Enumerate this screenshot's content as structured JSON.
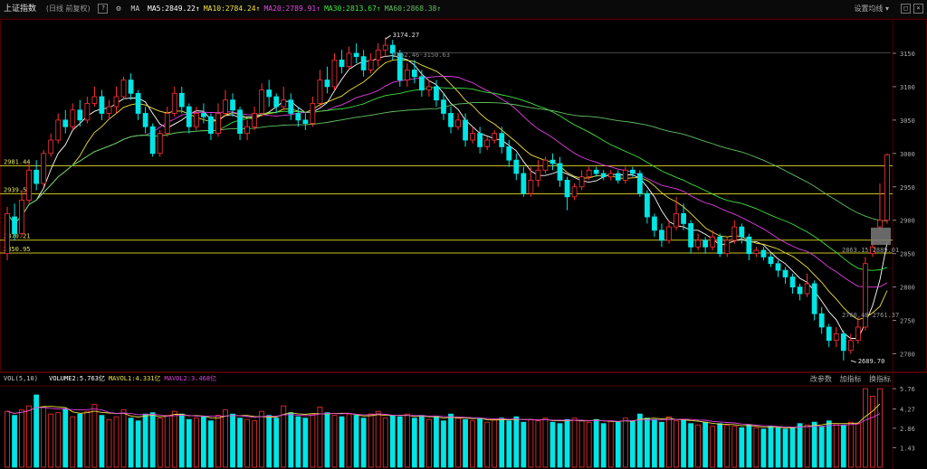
{
  "header": {
    "title": "上证指数",
    "subtitle": "(日线 前复权)",
    "help": "?",
    "ma_label": "MA",
    "ma": [
      {
        "label": "MA5:2849.22",
        "color": "#ffffff"
      },
      {
        "label": "MA10:2784.24",
        "color": "#f0e040"
      },
      {
        "label": "MA20:2789.91",
        "color": "#e040e0"
      },
      {
        "label": "MA30:2813.67",
        "color": "#40e040"
      },
      {
        "label": "MA60:2868.38",
        "color": "#60c060"
      }
    ],
    "settings": "设置均线"
  },
  "volume_header": {
    "title": "VOL(5,10)",
    "items": [
      {
        "label": "VOLUME2:5.763亿",
        "color": "#ffffff"
      },
      {
        "label": "MAVOL1:4.331亿",
        "color": "#f0e040"
      },
      {
        "label": "MAVOL2:3.468亿",
        "color": "#e040e0"
      }
    ],
    "right": [
      "改参数",
      "加指标",
      "换指标"
    ]
  },
  "chart_data": {
    "type": "candlestick",
    "price_axis": {
      "ticks": [
        3150,
        3100,
        3050,
        3000,
        2950,
        2900,
        2850,
        2800,
        2750,
        2700
      ],
      "ylim": [
        2675,
        3200
      ]
    },
    "volume_axis": {
      "ticks": [
        "5.76",
        "4.27",
        "2.86",
        "1.43"
      ]
    },
    "reference_lines": [
      {
        "value": 2981.44,
        "label": "2981.44"
      },
      {
        "value": 2939.53,
        "label": "2939.53"
      },
      {
        "value": 2870.21,
        "label": "2870.21"
      },
      {
        "value": 2850.95,
        "label": "2850.95"
      }
    ],
    "annotations": {
      "high": "3174.27",
      "high_range": "3162.46-3150.63",
      "low": "2689.70",
      "gap_top": "2863.15-2889.01",
      "gap_bottom": "2760.48-2761.37"
    },
    "candles": [
      [
        2850,
        2910,
        2840,
        2920
      ],
      [
        2905,
        2880,
        2870,
        2925
      ],
      [
        2880,
        2930,
        2875,
        2945
      ],
      [
        2930,
        2975,
        2925,
        2985
      ],
      [
        2975,
        2955,
        2945,
        2990
      ],
      [
        2955,
        3000,
        2950,
        3005
      ],
      [
        3000,
        3020,
        2995,
        3030
      ],
      [
        3020,
        3050,
        3015,
        3060
      ],
      [
        3050,
        3040,
        3030,
        3065
      ],
      [
        3040,
        3065,
        3035,
        3075
      ],
      [
        3065,
        3050,
        3040,
        3080
      ],
      [
        3050,
        3075,
        3045,
        3085
      ],
      [
        3075,
        3085,
        3070,
        3100
      ],
      [
        3085,
        3060,
        3050,
        3095
      ],
      [
        3060,
        3070,
        3050,
        3080
      ],
      [
        3070,
        3085,
        3060,
        3100
      ],
      [
        3085,
        3110,
        3080,
        3115
      ],
      [
        3110,
        3090,
        3080,
        3120
      ],
      [
        3090,
        3060,
        3050,
        3095
      ],
      [
        3060,
        3040,
        3030,
        3070
      ],
      [
        3040,
        3000,
        2995,
        3045
      ],
      [
        3000,
        3030,
        2995,
        3035
      ],
      [
        3030,
        3060,
        3025,
        3070
      ],
      [
        3060,
        3090,
        3055,
        3100
      ],
      [
        3090,
        3070,
        3060,
        3100
      ],
      [
        3070,
        3040,
        3030,
        3075
      ],
      [
        3040,
        3060,
        3035,
        3070
      ],
      [
        3060,
        3055,
        3045,
        3075
      ],
      [
        3055,
        3030,
        3020,
        3060
      ],
      [
        3030,
        3060,
        3025,
        3075
      ],
      [
        3060,
        3080,
        3055,
        3095
      ],
      [
        3080,
        3065,
        3055,
        3090
      ],
      [
        3065,
        3030,
        3020,
        3070
      ],
      [
        3030,
        3040,
        3020,
        3050
      ],
      [
        3040,
        3060,
        3035,
        3070
      ],
      [
        3060,
        3095,
        3055,
        3105
      ],
      [
        3095,
        3085,
        3070,
        3110
      ],
      [
        3085,
        3070,
        3060,
        3090
      ],
      [
        3070,
        3080,
        3065,
        3100
      ],
      [
        3080,
        3060,
        3050,
        3090
      ],
      [
        3060,
        3050,
        3040,
        3070
      ],
      [
        3050,
        3045,
        3035,
        3060
      ],
      [
        3045,
        3075,
        3040,
        3085
      ],
      [
        3075,
        3110,
        3070,
        3125
      ],
      [
        3110,
        3100,
        3090,
        3130
      ],
      [
        3100,
        3140,
        3095,
        3150
      ],
      [
        3140,
        3130,
        3120,
        3155
      ],
      [
        3130,
        3150,
        3125,
        3160
      ],
      [
        3150,
        3145,
        3135,
        3165
      ],
      [
        3145,
        3125,
        3115,
        3155
      ],
      [
        3125,
        3140,
        3120,
        3150
      ],
      [
        3140,
        3155,
        3130,
        3165
      ],
      [
        3155,
        3162,
        3145,
        3174
      ],
      [
        3162,
        3150,
        3140,
        3170
      ],
      [
        3150,
        3110,
        3100,
        3155
      ],
      [
        3110,
        3125,
        3100,
        3135
      ],
      [
        3125,
        3115,
        3105,
        3140
      ],
      [
        3115,
        3095,
        3085,
        3125
      ],
      [
        3095,
        3100,
        3085,
        3110
      ],
      [
        3100,
        3080,
        3070,
        3110
      ],
      [
        3080,
        3060,
        3050,
        3090
      ],
      [
        3060,
        3040,
        3030,
        3070
      ],
      [
        3040,
        3050,
        3035,
        3060
      ],
      [
        3050,
        3020,
        3010,
        3060
      ],
      [
        3020,
        3030,
        3015,
        3040
      ],
      [
        3030,
        3010,
        3000,
        3040
      ],
      [
        3010,
        3020,
        3005,
        3025
      ],
      [
        3020,
        3030,
        3015,
        3035
      ],
      [
        3030,
        3010,
        3000,
        3040
      ],
      [
        3010,
        2990,
        2980,
        3020
      ],
      [
        2990,
        2970,
        2960,
        3000
      ],
      [
        2970,
        2940,
        2935,
        2980
      ],
      [
        2940,
        2960,
        2935,
        2980
      ],
      [
        2960,
        2975,
        2950,
        2990
      ],
      [
        2975,
        2990,
        2970,
        2995
      ],
      [
        2990,
        2985,
        2975,
        3000
      ],
      [
        2985,
        2960,
        2950,
        2995
      ],
      [
        2960,
        2935,
        2915,
        2965
      ],
      [
        2935,
        2950,
        2930,
        2955
      ],
      [
        2950,
        2965,
        2945,
        2975
      ],
      [
        2965,
        2975,
        2960,
        2980
      ],
      [
        2975,
        2970,
        2965,
        2980
      ],
      [
        2970,
        2965,
        2960,
        2975
      ],
      [
        2965,
        2970,
        2960,
        2975
      ],
      [
        2970,
        2960,
        2955,
        2975
      ],
      [
        2960,
        2975,
        2955,
        2980
      ],
      [
        2975,
        2970,
        2965,
        2980
      ],
      [
        2970,
        2940,
        2935,
        2975
      ],
      [
        2940,
        2905,
        2895,
        2945
      ],
      [
        2905,
        2885,
        2875,
        2910
      ],
      [
        2885,
        2870,
        2860,
        2895
      ],
      [
        2870,
        2890,
        2865,
        2900
      ],
      [
        2890,
        2910,
        2885,
        2935
      ],
      [
        2910,
        2895,
        2885,
        2925
      ],
      [
        2895,
        2860,
        2850,
        2900
      ],
      [
        2860,
        2870,
        2855,
        2880
      ],
      [
        2870,
        2860,
        2850,
        2875
      ],
      [
        2860,
        2875,
        2855,
        2885
      ],
      [
        2875,
        2850,
        2845,
        2880
      ],
      [
        2850,
        2870,
        2845,
        2875
      ],
      [
        2870,
        2890,
        2865,
        2900
      ],
      [
        2890,
        2875,
        2865,
        2895
      ],
      [
        2875,
        2850,
        2840,
        2880
      ],
      [
        2850,
        2855,
        2845,
        2860
      ],
      [
        2855,
        2845,
        2840,
        2860
      ],
      [
        2845,
        2835,
        2830,
        2850
      ],
      [
        2835,
        2825,
        2815,
        2840
      ],
      [
        2825,
        2815,
        2805,
        2830
      ],
      [
        2815,
        2800,
        2790,
        2820
      ],
      [
        2800,
        2790,
        2780,
        2805
      ],
      [
        2790,
        2805,
        2785,
        2820
      ],
      [
        2805,
        2760,
        2750,
        2810
      ],
      [
        2760,
        2740,
        2730,
        2770
      ],
      [
        2740,
        2720,
        2710,
        2745
      ],
      [
        2720,
        2730,
        2710,
        2740
      ],
      [
        2730,
        2705,
        2690,
        2735
      ],
      [
        2705,
        2720,
        2700,
        2730
      ],
      [
        2720,
        2740,
        2715,
        2755
      ],
      [
        2740,
        2835,
        2735,
        2845
      ],
      [
        2850,
        2860,
        2845,
        2870
      ],
      [
        2890,
        2900,
        2885,
        2955
      ],
      [
        2900,
        2998,
        2895,
        3000
      ]
    ],
    "volume": [
      4.1,
      3.8,
      4.2,
      4.5,
      5.3,
      4.4,
      3.9,
      4.0,
      4.3,
      3.7,
      3.9,
      4.1,
      4.6,
      3.8,
      3.5,
      3.7,
      4.2,
      3.6,
      3.4,
      3.9,
      4.0,
      3.6,
      3.8,
      4.1,
      3.9,
      3.5,
      3.6,
      3.7,
      3.4,
      3.8,
      4.2,
      3.9,
      3.6,
      3.5,
      3.4,
      4.1,
      3.8,
      3.6,
      4.5,
      4.0,
      3.7,
      3.6,
      3.9,
      4.4,
      4.0,
      3.8,
      3.7,
      3.9,
      3.8,
      3.6,
      3.9,
      4.1,
      3.6,
      3.8,
      3.7,
      3.9,
      3.6,
      3.8,
      3.5,
      3.7,
      3.4,
      3.9,
      3.6,
      3.5,
      3.4,
      3.6,
      3.3,
      3.5,
      3.6,
      3.4,
      3.7,
      3.3,
      3.5,
      3.4,
      3.6,
      3.3,
      3.2,
      3.5,
      3.6,
      3.4,
      3.3,
      3.5,
      3.2,
      3.4,
      3.3,
      3.6,
      3.4,
      3.9,
      3.6,
      3.5,
      3.3,
      3.7,
      3.4,
      3.5,
      3.2,
      3.1,
      3.3,
      3.0,
      3.2,
      3.1,
      3.0,
      2.9,
      3.1,
      2.9,
      2.8,
      3.0,
      2.9,
      2.8,
      2.9,
      3.2,
      3.1,
      3.3,
      3.0,
      3.4,
      3.2,
      3.1,
      3.3,
      3.2,
      5.76,
      5.2,
      5.76
    ]
  }
}
